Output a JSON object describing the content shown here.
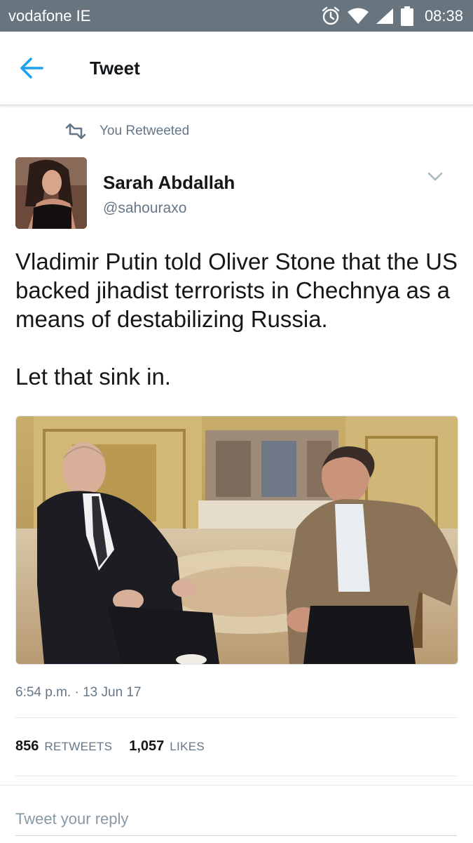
{
  "status_bar": {
    "carrier": "vodafone IE",
    "time": "08:38",
    "icons": [
      "alarm-icon",
      "wifi-icon",
      "signal-icon",
      "battery-icon"
    ]
  },
  "toolbar": {
    "back_icon": "back-arrow-icon",
    "title": "Tweet"
  },
  "retweet_context": {
    "icon": "retweet-icon",
    "text": "You Retweeted"
  },
  "tweet": {
    "author_name": "Sarah Abdallah",
    "author_handle": "@sahouraxo",
    "text": "Vladimir Putin told Oliver Stone that the US backed jihadist terrorists in Chechnya as a means of destabilizing Russia.\n\nLet that sink in.",
    "timestamp": "6:54 p.m. · 13 Jun 17",
    "retweets_count": "856",
    "retweets_label": "RETWEETS",
    "likes_count": "1,057",
    "likes_label": "LIKES"
  },
  "reply": {
    "placeholder": "Tweet your reply"
  },
  "colors": {
    "status_bar": "#68757f",
    "accent": "#1da1f2",
    "secondary_text": "#657786"
  }
}
